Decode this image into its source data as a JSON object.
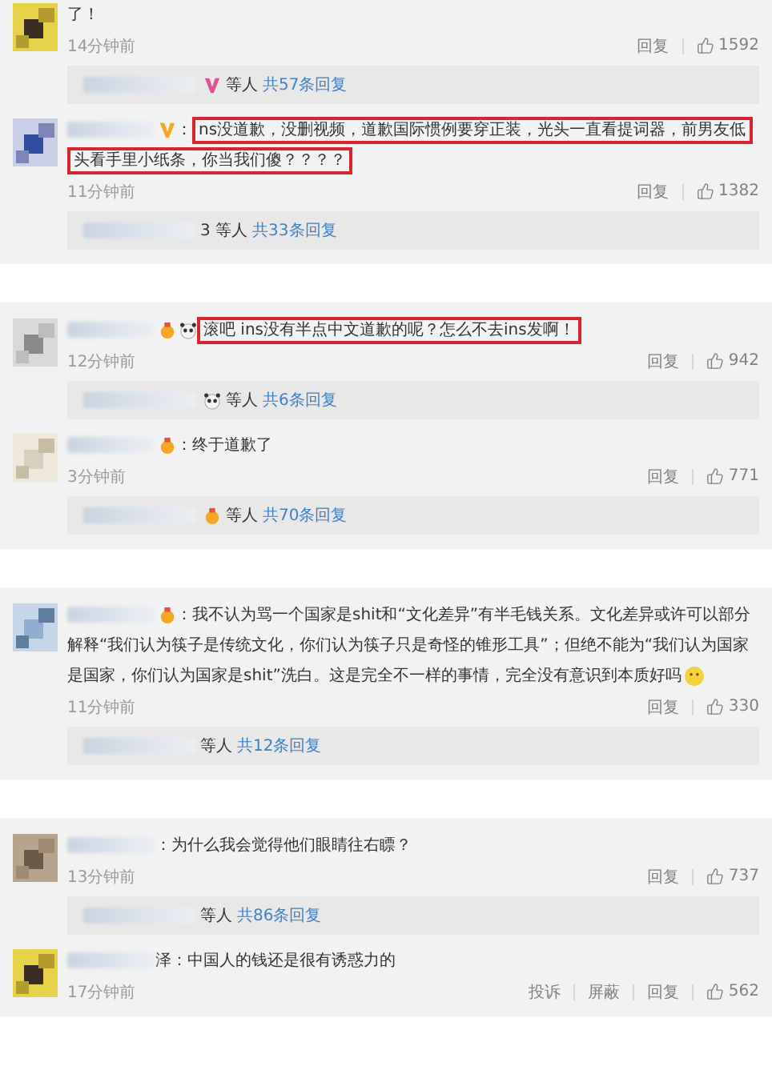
{
  "panels": [
    {
      "comments": [
        {
          "text": "了！",
          "time": "14分钟前",
          "actions": [
            "回复"
          ],
          "likes": "1592",
          "replies": {
            "badges": [
              {
                "kind": "v",
                "color": "#e0509a"
              }
            ],
            "who": "等人",
            "count": "共57条回复"
          }
        },
        {
          "badges": [
            {
              "kind": "v",
              "color": "#f5a623"
            }
          ],
          "separator": "：",
          "text": "ns没道歉，没删视频，道歉国际惯例要穿正装，光头一直看提词器，前男友低头看手里小纸条，你当我们傻？？？？",
          "highlighted": true,
          "time": "11分钟前",
          "actions": [
            "回复"
          ],
          "likes": "1382",
          "replies": {
            "who": "3 等人",
            "count": "共33条回复"
          }
        }
      ]
    },
    {
      "comments": [
        {
          "badges": [
            {
              "kind": "medal"
            },
            {
              "kind": "panda"
            }
          ],
          "text": "滚吧 ins没有半点中文道歉的呢？怎么不去ins发啊！",
          "highlighted": true,
          "time": "12分钟前",
          "actions": [
            "回复"
          ],
          "likes": "942",
          "replies": {
            "badges": [
              {
                "kind": "panda"
              }
            ],
            "who": "等人",
            "count": "共6条回复"
          }
        },
        {
          "badges": [
            {
              "kind": "medal"
            }
          ],
          "separator": "：",
          "text": "终于道歉了",
          "highlighted": false,
          "time": "3分钟前",
          "actions": [
            "回复"
          ],
          "likes": "771",
          "replies": {
            "badges": [
              {
                "kind": "medal"
              }
            ],
            "who": "等人",
            "count": "共70条回复"
          }
        }
      ]
    },
    {
      "comments": [
        {
          "badges": [
            {
              "kind": "medal"
            }
          ],
          "separator": "：",
          "text": "我不认为骂一个国家是shit和“文化差异”有半毛钱关系。文化差异或许可以部分解释“我们认为筷子是传统文化，你们认为筷子只是奇怪的锥形工具”；但绝不能为“我们认为国家是国家，你们认为国家是shit”洗白。这是完全不一样的事情，完全没有意识到本质好吗",
          "trailing_badges": [
            {
              "kind": "smile"
            }
          ],
          "highlighted": false,
          "time": "11分钟前",
          "actions": [
            "回复"
          ],
          "likes": "330",
          "replies": {
            "who": "等人",
            "count": "共12条回复"
          }
        }
      ]
    },
    {
      "comments": [
        {
          "separator": "：",
          "text": "为什么我会觉得他们眼睛往右瞟？",
          "highlighted": false,
          "time": "13分钟前",
          "actions": [
            "回复"
          ],
          "likes": "737",
          "replies": {
            "who": "等人",
            "count": "共86条回复"
          }
        },
        {
          "text": "泽：中国人的钱还是很有诱惑力的",
          "highlighted": false,
          "time": "17分钟前",
          "actions": [
            "投诉",
            "屏蔽",
            "回复"
          ],
          "likes": "562"
        }
      ]
    }
  ]
}
